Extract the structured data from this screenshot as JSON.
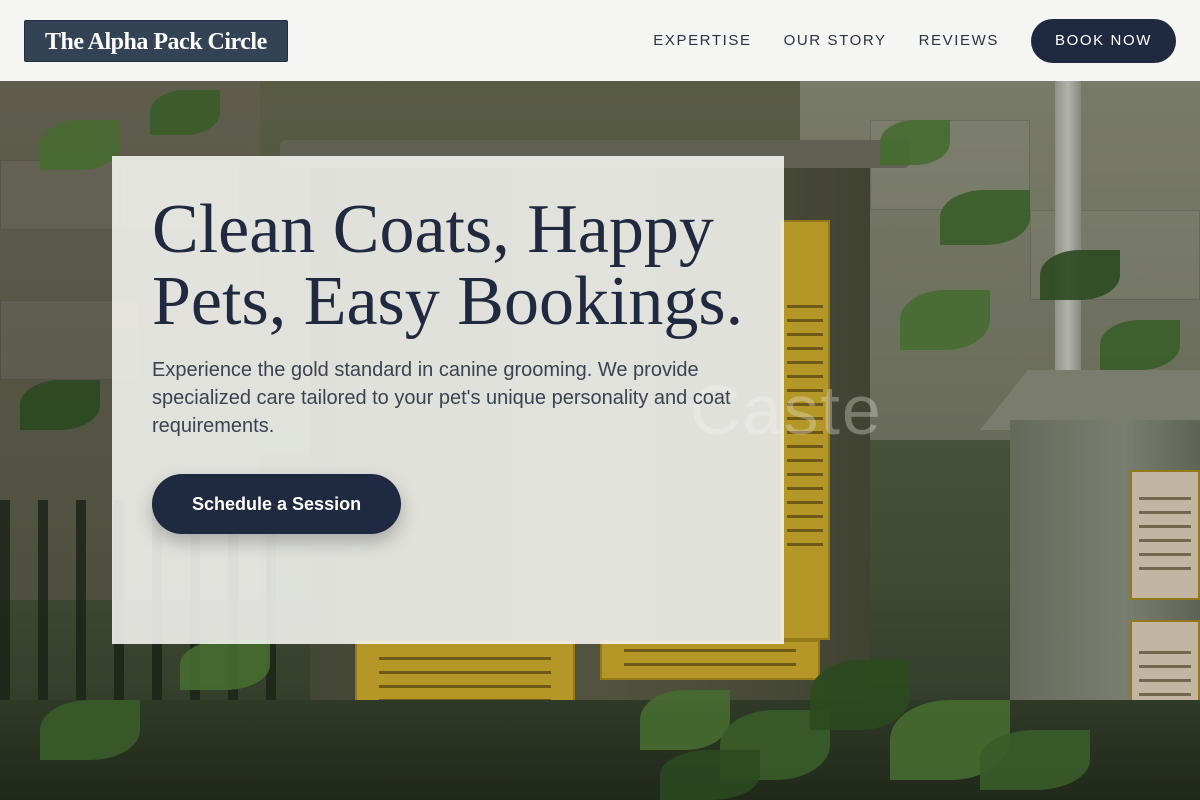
{
  "header": {
    "logo_text": "The Alpha Pack Circle",
    "nav": [
      {
        "label": "EXPERTISE"
      },
      {
        "label": "OUR STORY"
      },
      {
        "label": "REVIEWS"
      }
    ],
    "book_label": "BOOK NOW"
  },
  "hero": {
    "title": "Clean Coats, Happy Pets, Easy Bookings.",
    "description": "Experience the gold standard in canine grooming. We provide specialized care tailored to your pet's unique personality and coat requirements.",
    "cta_label": "Schedule a Session"
  },
  "background": {
    "ghost_text": "Caste"
  },
  "colors": {
    "primary": "#1f2a40",
    "logo_bg": "#344256",
    "header_bg": "#fafafa",
    "card_bg": "#f6f6f2"
  }
}
